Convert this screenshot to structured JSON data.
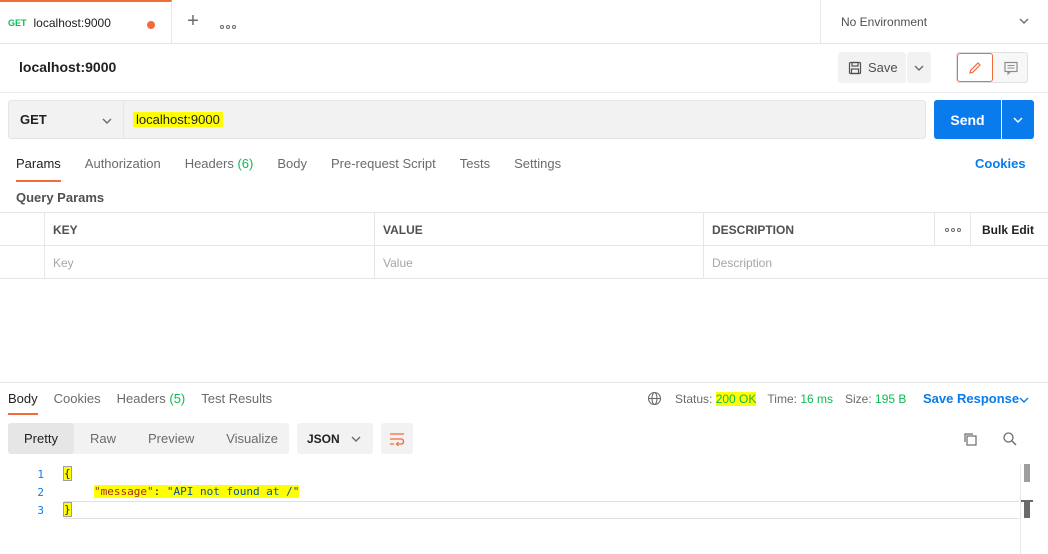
{
  "tabbar": {
    "tab": {
      "method": "GET",
      "name": "localhost:9000",
      "unsaved": true
    },
    "environment": "No Environment"
  },
  "request": {
    "title": "localhost:9000",
    "save_label": "Save",
    "method": "GET",
    "url": "localhost:9000",
    "send_label": "Send"
  },
  "request_tabs": [
    {
      "label": "Params",
      "active": true
    },
    {
      "label": "Authorization"
    },
    {
      "label": "Headers",
      "count": "(6)"
    },
    {
      "label": "Body"
    },
    {
      "label": "Pre-request Script"
    },
    {
      "label": "Tests"
    },
    {
      "label": "Settings"
    }
  ],
  "cookies_link": "Cookies",
  "query_params": {
    "title": "Query Params",
    "headers": {
      "key": "KEY",
      "value": "VALUE",
      "description": "DESCRIPTION",
      "bulk_edit": "Bulk Edit"
    },
    "placeholders": {
      "key": "Key",
      "value": "Value",
      "description": "Description"
    }
  },
  "response": {
    "tabs": [
      {
        "label": "Body",
        "active": true
      },
      {
        "label": "Cookies"
      },
      {
        "label": "Headers",
        "count": "(5)"
      },
      {
        "label": "Test Results"
      }
    ],
    "status_label": "Status:",
    "status_value": "200 OK",
    "time_label": "Time:",
    "time_value": "16 ms",
    "size_label": "Size:",
    "size_value": "195 B",
    "save_response": "Save Response",
    "views": [
      "Pretty",
      "Raw",
      "Preview",
      "Visualize"
    ],
    "format": "JSON",
    "lines": [
      "1",
      "2",
      "3"
    ],
    "code": {
      "open": "{",
      "key": "\"message\"",
      "sep": ": ",
      "value": "\"API not found at /\"",
      "close": "}"
    }
  },
  "colors": {
    "accent": "#f26b3a",
    "primary": "#097bed",
    "success": "#0cbb52",
    "highlight": "#ffff00"
  }
}
